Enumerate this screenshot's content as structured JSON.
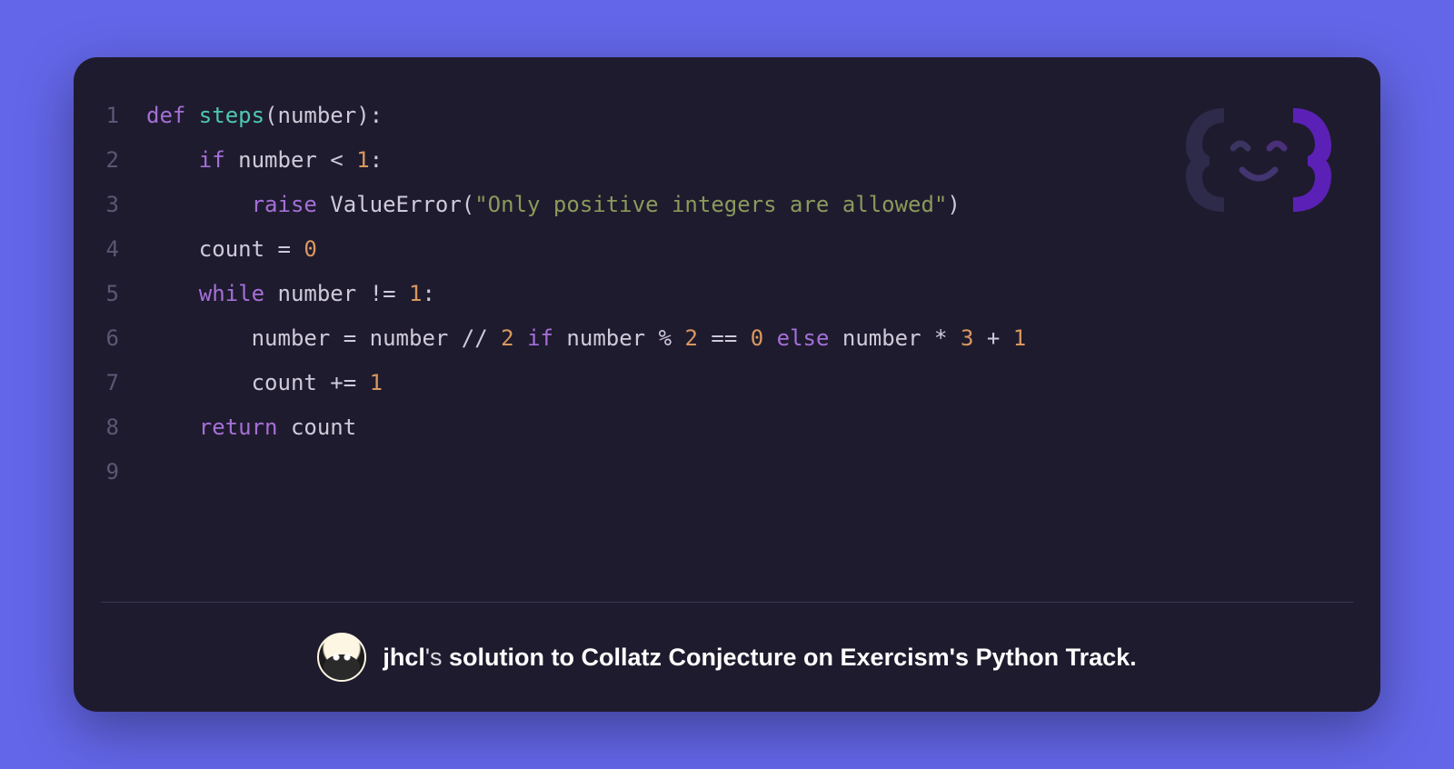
{
  "code": {
    "lines": [
      {
        "n": "1",
        "tokens": [
          {
            "t": "def ",
            "c": "kw"
          },
          {
            "t": "steps",
            "c": "fn"
          },
          {
            "t": "(number):",
            "c": "param"
          }
        ]
      },
      {
        "n": "2",
        "tokens": [
          {
            "t": "    ",
            "c": ""
          },
          {
            "t": "if",
            "c": "kw"
          },
          {
            "t": " number ",
            "c": "param"
          },
          {
            "t": "<",
            "c": "op"
          },
          {
            "t": " ",
            "c": ""
          },
          {
            "t": "1",
            "c": "num"
          },
          {
            "t": ":",
            "c": "op"
          }
        ]
      },
      {
        "n": "3",
        "tokens": [
          {
            "t": "        ",
            "c": ""
          },
          {
            "t": "raise",
            "c": "kw"
          },
          {
            "t": " ValueError(",
            "c": "cls"
          },
          {
            "t": "\"Only positive integers are allowed\"",
            "c": "str"
          },
          {
            "t": ")",
            "c": "cls"
          }
        ]
      },
      {
        "n": "4",
        "tokens": [
          {
            "t": "    count ",
            "c": "param"
          },
          {
            "t": "=",
            "c": "op"
          },
          {
            "t": " ",
            "c": ""
          },
          {
            "t": "0",
            "c": "num"
          }
        ]
      },
      {
        "n": "5",
        "tokens": [
          {
            "t": "    ",
            "c": ""
          },
          {
            "t": "while",
            "c": "kw"
          },
          {
            "t": " number ",
            "c": "param"
          },
          {
            "t": "!=",
            "c": "op"
          },
          {
            "t": " ",
            "c": ""
          },
          {
            "t": "1",
            "c": "num"
          },
          {
            "t": ":",
            "c": "op"
          }
        ]
      },
      {
        "n": "6",
        "tokens": [
          {
            "t": "        number ",
            "c": "param"
          },
          {
            "t": "=",
            "c": "op"
          },
          {
            "t": " number ",
            "c": "param"
          },
          {
            "t": "//",
            "c": "op"
          },
          {
            "t": " ",
            "c": ""
          },
          {
            "t": "2",
            "c": "num"
          },
          {
            "t": " ",
            "c": ""
          },
          {
            "t": "if",
            "c": "kw"
          },
          {
            "t": " number ",
            "c": "param"
          },
          {
            "t": "%",
            "c": "op"
          },
          {
            "t": " ",
            "c": ""
          },
          {
            "t": "2",
            "c": "num"
          },
          {
            "t": " ",
            "c": ""
          },
          {
            "t": "==",
            "c": "op"
          },
          {
            "t": " ",
            "c": ""
          },
          {
            "t": "0",
            "c": "num"
          },
          {
            "t": " ",
            "c": ""
          },
          {
            "t": "else",
            "c": "kw"
          },
          {
            "t": " number ",
            "c": "param"
          },
          {
            "t": "*",
            "c": "op"
          },
          {
            "t": " ",
            "c": ""
          },
          {
            "t": "3",
            "c": "num"
          },
          {
            "t": " ",
            "c": ""
          },
          {
            "t": "+",
            "c": "op"
          },
          {
            "t": " ",
            "c": ""
          },
          {
            "t": "1",
            "c": "num"
          }
        ]
      },
      {
        "n": "7",
        "tokens": [
          {
            "t": "        count ",
            "c": "param"
          },
          {
            "t": "+=",
            "c": "op"
          },
          {
            "t": " ",
            "c": ""
          },
          {
            "t": "1",
            "c": "num"
          }
        ]
      },
      {
        "n": "8",
        "tokens": [
          {
            "t": "    ",
            "c": ""
          },
          {
            "t": "return",
            "c": "kw"
          },
          {
            "t": " count",
            "c": "param"
          }
        ]
      },
      {
        "n": "9",
        "tokens": []
      }
    ]
  },
  "footer": {
    "user": "jhcl",
    "t1": "'s ",
    "t2": "solution to",
    "t3": " ",
    "exercise": "Collatz Conjecture",
    "t4": " ",
    "t5": "on Exercism's",
    "t6": " ",
    "track": "Python Track."
  },
  "colors": {
    "background": "#6366e8",
    "card": "#1f1b2e",
    "logo_left": "#2d2a4a",
    "logo_right": "#5b21b6"
  }
}
